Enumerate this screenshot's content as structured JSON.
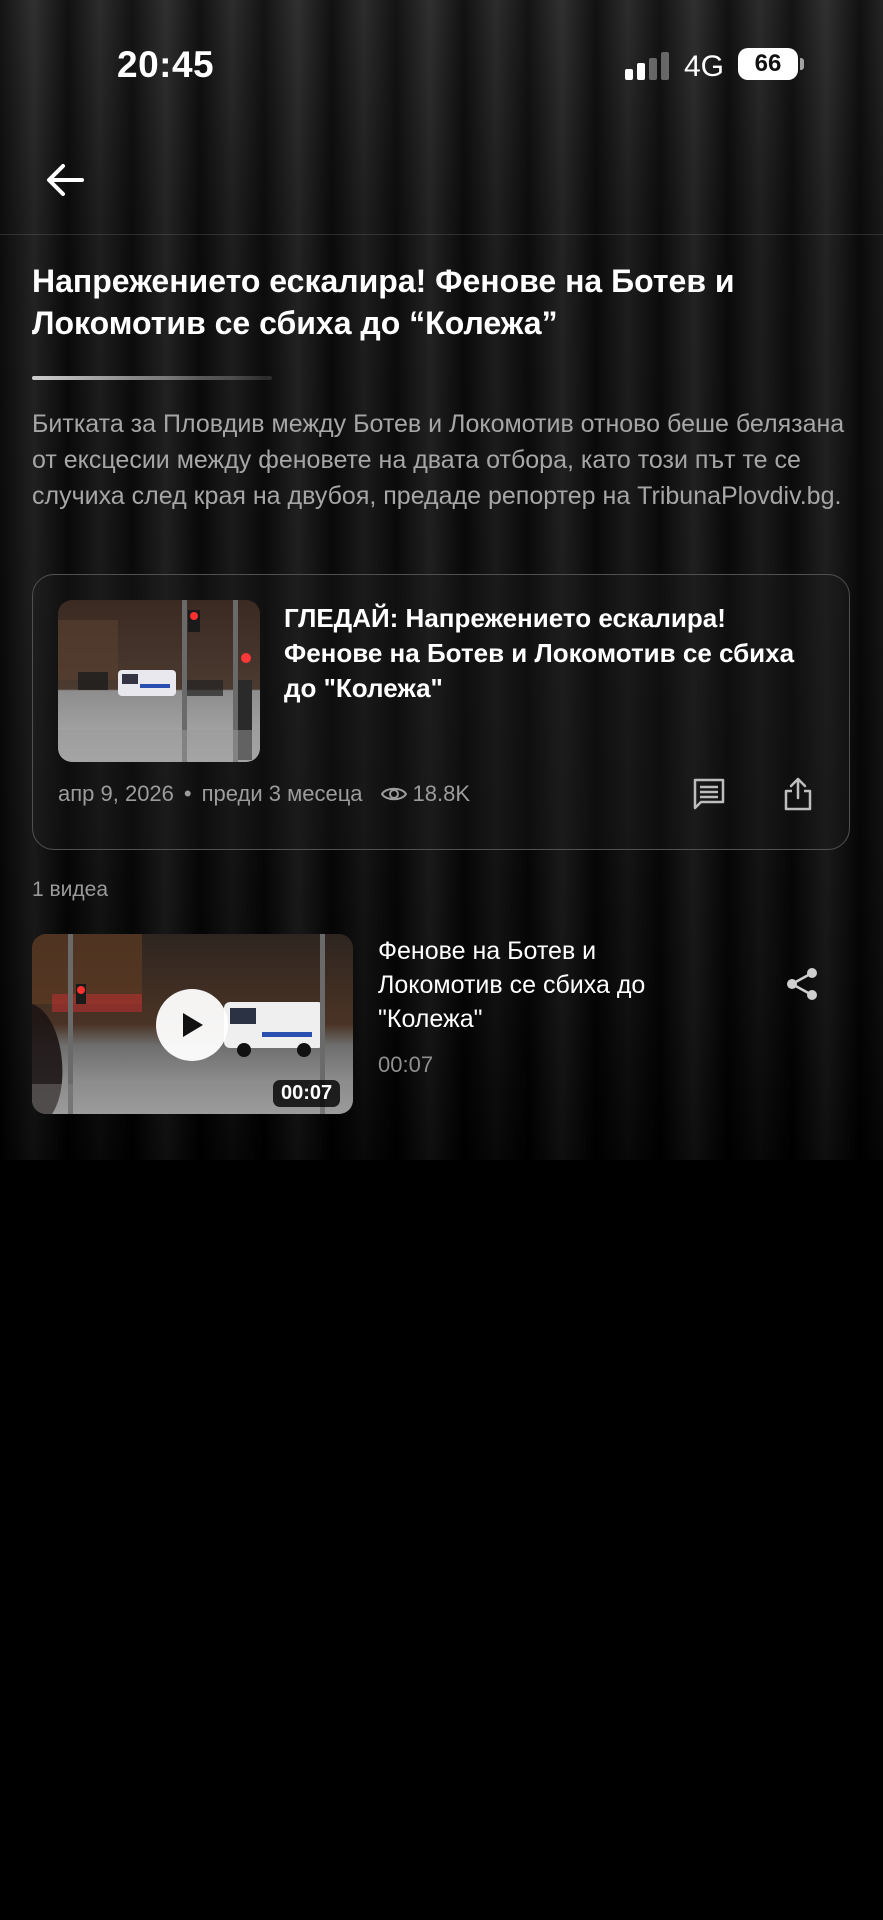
{
  "status_bar": {
    "time": "20:45",
    "network": "4G",
    "battery": "66"
  },
  "article": {
    "title": "Напрежението ескалира! Фенове на Ботев и Локомотив се сбиха до “Колежа”",
    "summary": "Битката за Пловдив между Ботев и Локомотив отново беше белязана от ексцесии между феновете на двата отбора, като този път те се случиха след края на двубоя, предаде репортер на TribunaPlovdiv.bg."
  },
  "featured_video": {
    "title": "ГЛЕДАЙ: Напрежението ескалира! Фенове на Ботев и Локомотив се сбиха до \"Колежа\"",
    "date": "апр 9, 2026",
    "separator": "•",
    "relative_time": "преди 3 месеца",
    "views": "18.8K"
  },
  "videos_count": "1 видеа",
  "videos": [
    {
      "title": "Фенове на Ботев и Локомотив се сбиха до \"Колежа\"",
      "duration": "00:07"
    }
  ],
  "icons": {
    "back": "arrow-left-icon",
    "views": "eye-icon",
    "comments": "comment-icon",
    "share_card": "share-upload-icon",
    "play": "play-icon",
    "share": "share-nodes-icon"
  },
  "colors": {
    "background": "#000000",
    "muted_text": "#a6a6a6",
    "card_border": "#505050"
  }
}
